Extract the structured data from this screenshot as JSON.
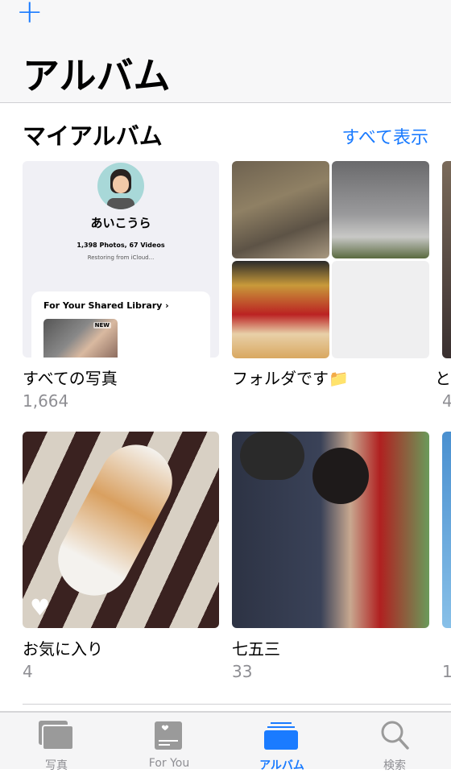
{
  "header": {
    "add_icon": "plus-icon",
    "title": "アルバム"
  },
  "section": {
    "title": "マイアルバム",
    "see_all": "すべて表示"
  },
  "recents_cover": {
    "profile_name": "あいこうら",
    "stats": "1,398 Photos, 67 Videos",
    "status": "Restoring from iCloud...",
    "shared_library": "For Your Shared Library ›",
    "badge": "NEW"
  },
  "albums": [
    {
      "name": "すべての写真",
      "count": "1,664"
    },
    {
      "name": "フォルダです📁",
      "count": ""
    },
    {
      "name": "と",
      "count": "4"
    },
    {
      "name": "お気に入り",
      "count": "4"
    },
    {
      "name": "七五三",
      "count": "33"
    },
    {
      "name": "",
      "count": "1"
    }
  ],
  "tabs": [
    {
      "label": "写真",
      "icon": "photos-icon"
    },
    {
      "label": "For You",
      "icon": "for-you-icon"
    },
    {
      "label": "アルバム",
      "icon": "albums-icon",
      "active": true
    },
    {
      "label": "検索",
      "icon": "search-icon"
    }
  ],
  "colors": {
    "accent": "#1a7bff",
    "inactive": "#8e8e93"
  }
}
